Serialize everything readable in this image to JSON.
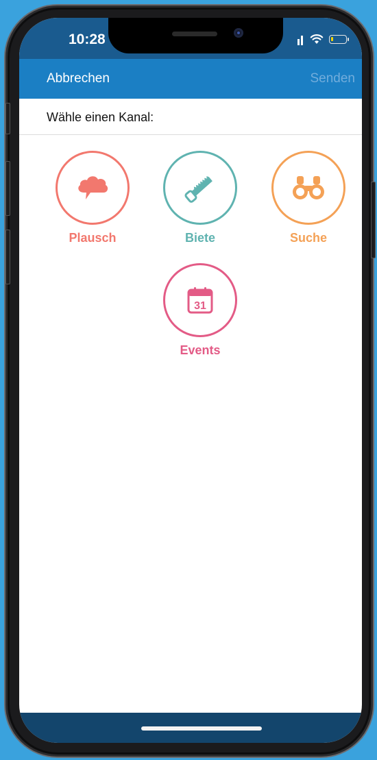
{
  "status_bar": {
    "time": "10:28"
  },
  "navbar": {
    "cancel_label": "Abbrechen",
    "send_label": "Senden"
  },
  "prompt": {
    "text": "Wähle einen Kanal:"
  },
  "channels": [
    {
      "label": "Plausch",
      "icon": "speech-cloud-icon",
      "color": "#f2786e"
    },
    {
      "label": "Biete",
      "icon": "saw-icon",
      "color": "#5fb3b0"
    },
    {
      "label": "Suche",
      "icon": "binoculars-icon",
      "color": "#f4a156"
    },
    {
      "label": "Events",
      "icon": "calendar-icon",
      "color": "#e35b86",
      "calendar_day": "31"
    }
  ],
  "colors": {
    "navbar": "#1b7fc4",
    "status_bar": "#1a5b8f",
    "background": "#3aa2dd"
  }
}
